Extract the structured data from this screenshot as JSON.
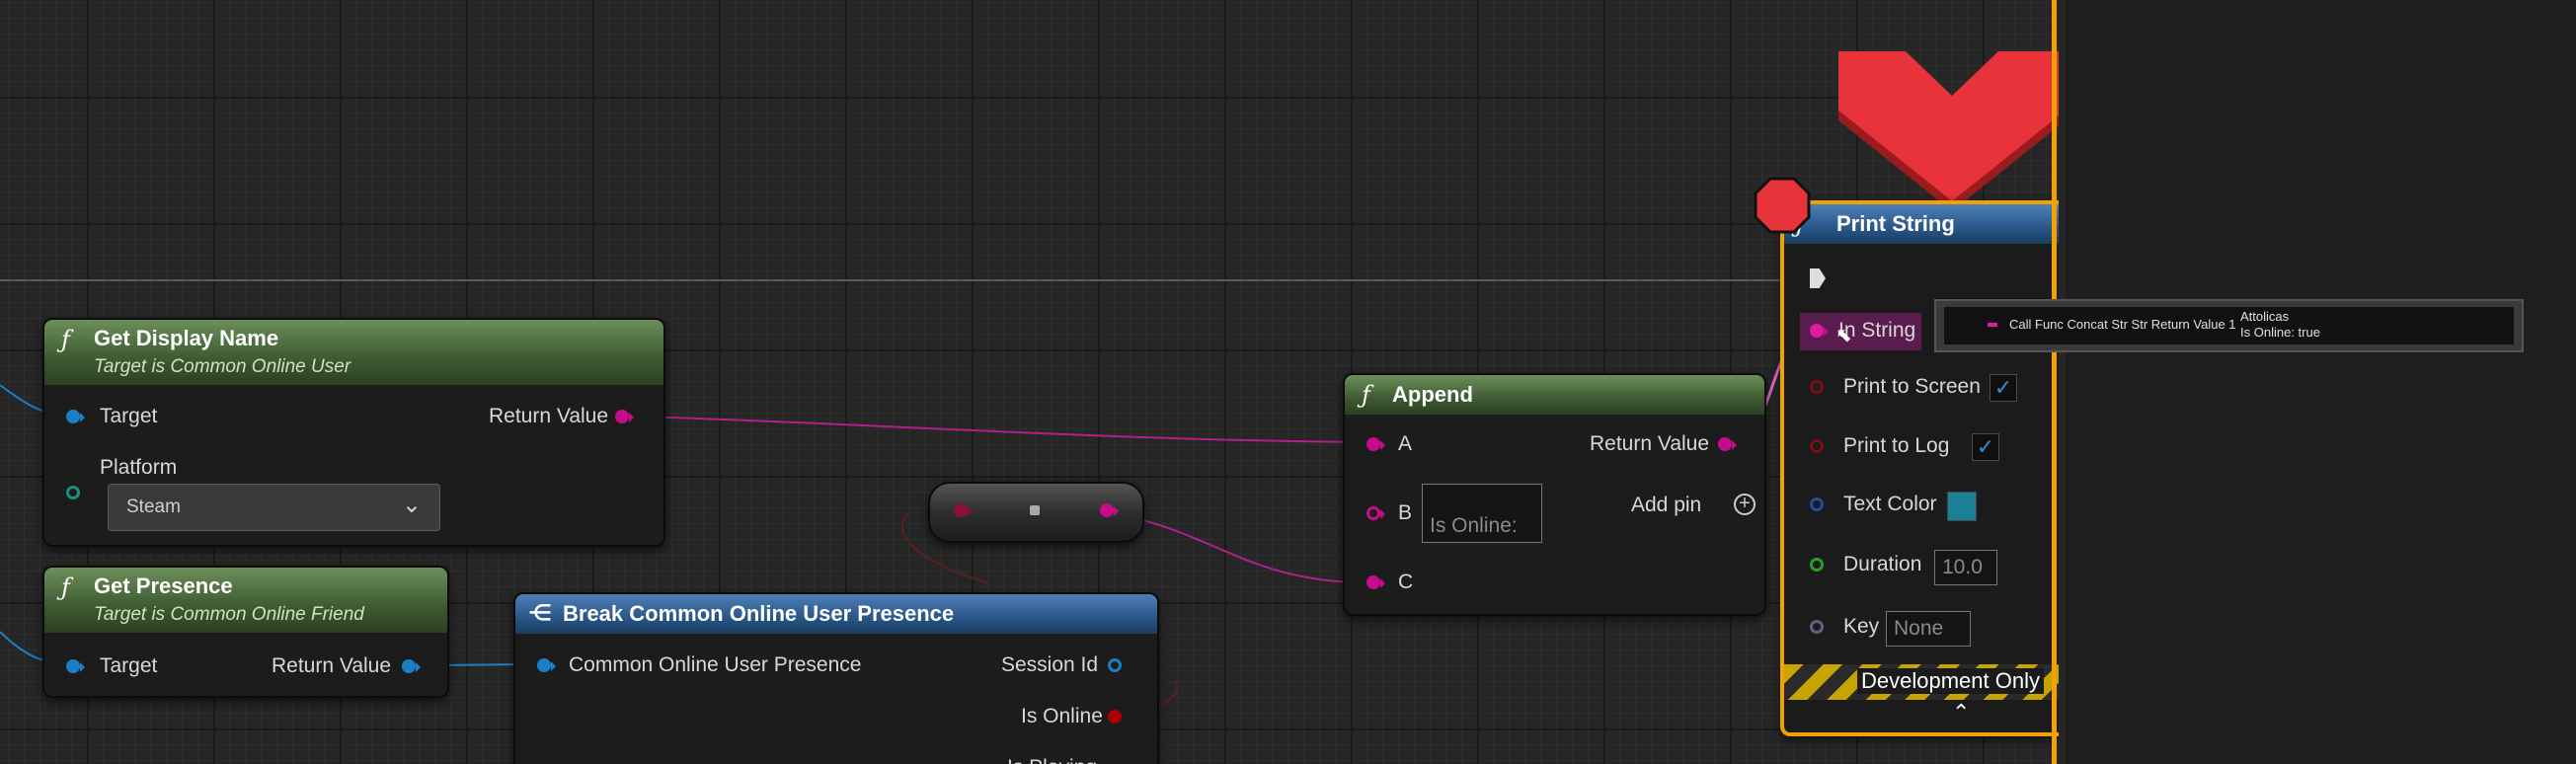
{
  "colors": {
    "accent_orange": "#f2a100",
    "exec_red": "#e8333a",
    "string_pink": "#c40c8c",
    "struct_blue": "#1b7fc6",
    "bool_red": "#a00000"
  },
  "nodes": {
    "get_display_name": {
      "title": "Get Display Name",
      "subtitle": "Target is Common Online User",
      "icon": "function-icon",
      "pins": {
        "target": "Target",
        "return_value": "Return Value",
        "platform": "Platform"
      },
      "platform_value": "Steam"
    },
    "get_presence": {
      "title": "Get Presence",
      "subtitle": "Target is Common Online Friend",
      "icon": "function-icon",
      "pins": {
        "target": "Target",
        "return_value": "Return Value"
      }
    },
    "break_presence": {
      "title": "Break Common Online User Presence",
      "icon": "break-struct-icon",
      "pins": {
        "input": "Common Online User Presence",
        "session_id": "Session Id",
        "is_online": "Is Online",
        "is_playing": "Is Playing"
      }
    },
    "append": {
      "title": "Append",
      "icon": "function-icon",
      "pins": {
        "a": "A",
        "b": "B",
        "c": "C",
        "return_value": "Return Value",
        "add_pin": "Add pin"
      },
      "b_value": "Is Online:"
    },
    "print_string": {
      "title": "Print String",
      "icon": "function-icon",
      "pins": {
        "in_string": "In String",
        "print_to_screen": "Print to Screen",
        "print_to_log": "Print to Log",
        "text_color": "Text Color",
        "duration": "Duration",
        "key": "Key"
      },
      "duration_value": "10.0",
      "key_value": "None",
      "print_to_screen_checked": true,
      "print_to_log_checked": true,
      "text_color_value": "#1b7f96",
      "footer": "Development Only"
    }
  },
  "tooltip": {
    "label": "Call Func Concat Str Str Return Value 1",
    "value_line1": "Attolicas",
    "value_line2": "Is Online: true"
  }
}
